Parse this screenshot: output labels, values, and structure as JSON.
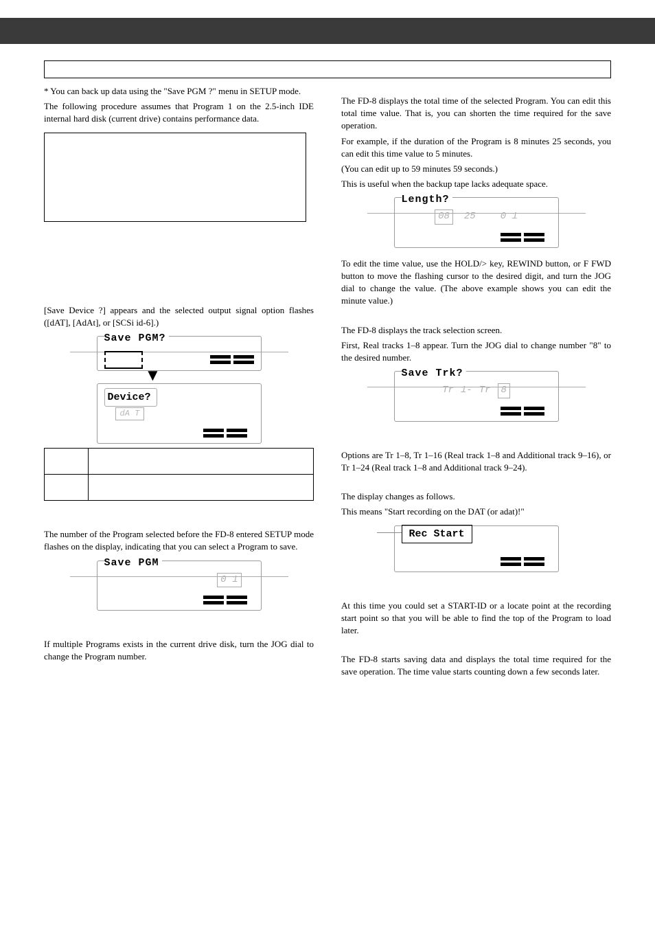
{
  "left": {
    "intro1": "* You can back up data using the \"Save PGM ?\" menu in SETUP mode.",
    "intro2": "The following procedure assumes that Program 1 on the 2.5-inch IDE internal hard disk (current drive) contains performance data.",
    "saveDeviceNote": "[Save Device ?] appears and the selected output signal option flashes ([dAT], [AdAt], or [SCSi id-6].)",
    "lcd1_title": "Save PGM?",
    "device_label": "Device?",
    "device_seg": "dA   T",
    "programNote": "The number of the Program selected before the FD-8 entered SETUP mode flashes on the display, indicating that you can select a Program to save.",
    "lcd2_title": "Save PGM",
    "lcd2_seg": "0 1",
    "jogNote": "If multiple Programs exists in the current drive disk, turn the JOG dial to change the Program number."
  },
  "right": {
    "totalTime1": "The FD-8 displays the total time of the selected Program. You can edit this total time value.  That is, you can shorten the time required for the save operation.",
    "totalTime2": "For example, if the duration of the Program is 8 minutes 25 seconds, you can edit this time value to 5 minutes.",
    "totalTime3": "(You can edit up to 59 minutes 59 seconds.)",
    "totalTime4": "This is useful when the backup tape lacks adequate space.",
    "lcd_len_title": "Length?",
    "lcd_len_seg1": "08",
    "lcd_len_v1": "25",
    "lcd_len_v2": "0 1",
    "editNote": "To edit the time value, use the HOLD/> key, REWIND button, or F FWD button to move the flashing cursor to the desired digit, and turn the JOG dial to change the value. (The above example shows you can edit the minute value.)",
    "trk1": "The FD-8 displays the track selection screen.",
    "trk2": "First, Real tracks 1–8 appear. Turn the JOG dial to change number \"8\" to the desired number.",
    "lcd_trk_title": "Save Trk?",
    "lcd_trk_v1": "Tr",
    "lcd_trk_v2": "1-",
    "lcd_trk_v3": "Tr",
    "lcd_trk_seg": "8",
    "options": "Options are Tr 1–8, Tr 1–16 (Real track 1–8 and Additional track 9–16), or Tr 1–24 (Real track 1–8 and Additional track 9–24).",
    "disp1": "The display changes as follows.",
    "disp2": "This means \"Start recording on the DAT (or adat)!\"",
    "lcd_rec_title": "Rec Start",
    "startId": "At this time you could set a START-ID or a locate point at the recording start point so that you will be able to find the top of the Program to load later.",
    "saving": "The FD-8 starts saving data and displays the total time required for the save operation. The time value starts counting down a few seconds later."
  }
}
